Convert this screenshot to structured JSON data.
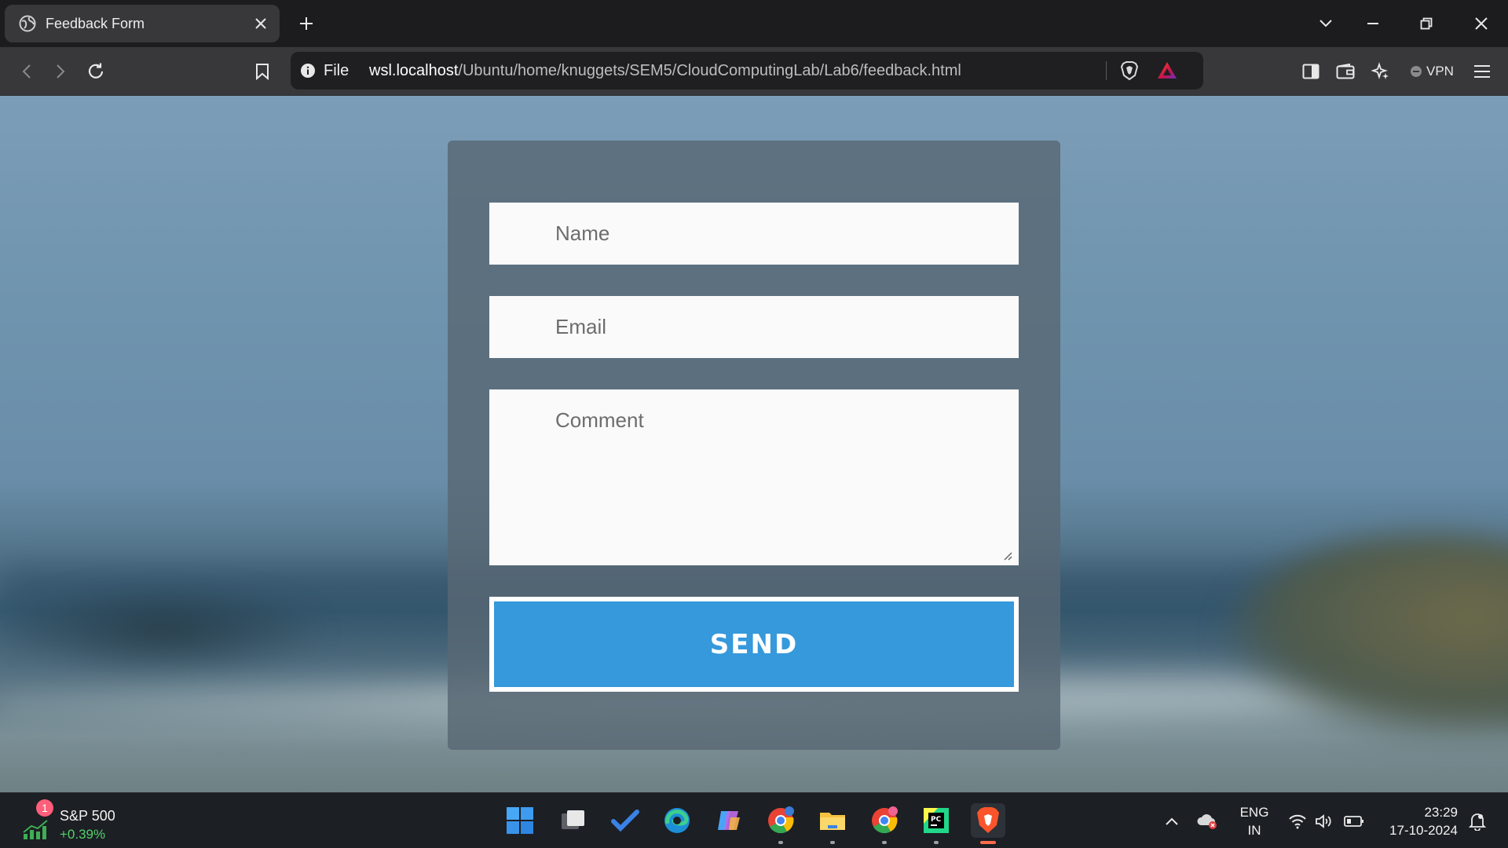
{
  "browser": {
    "tab": {
      "title": "Feedback Form"
    },
    "address": {
      "scheme_label": "File",
      "host": "wsl.localhost",
      "path": "/Ubuntu/home/knuggets/SEM5/CloudComputingLab/Lab6/feedback.html"
    },
    "vpn_label": "VPN",
    "icons": [
      "back-icon",
      "forward-icon",
      "reload-icon",
      "bookmark-icon",
      "info-icon",
      "brave-shield-icon",
      "brave-rewards-icon",
      "sidebar-icon",
      "wallet-icon",
      "leo-ai-icon",
      "menu-icon",
      "tab-list-chevron-icon",
      "minimize-icon",
      "restore-icon",
      "close-icon"
    ]
  },
  "form": {
    "name_placeholder": "Name",
    "email_placeholder": "Email",
    "comment_placeholder": "Comment",
    "send_label": "SEND",
    "accent_color": "#3699db"
  },
  "taskbar": {
    "widget": {
      "badge": "1",
      "title": "S&P 500",
      "value": "+0.39%",
      "value_color": "#55d06a"
    },
    "apps": [
      "start-icon",
      "task-view-icon",
      "todo-icon",
      "edge-icon",
      "copilot-icon",
      "chrome-icon",
      "file-explorer-icon",
      "chrome-profile-icon",
      "pycharm-icon",
      "brave-icon"
    ],
    "tray": {
      "lang_line1": "ENG",
      "lang_line2": "IN",
      "time": "23:29",
      "date": "17-10-2024"
    }
  }
}
